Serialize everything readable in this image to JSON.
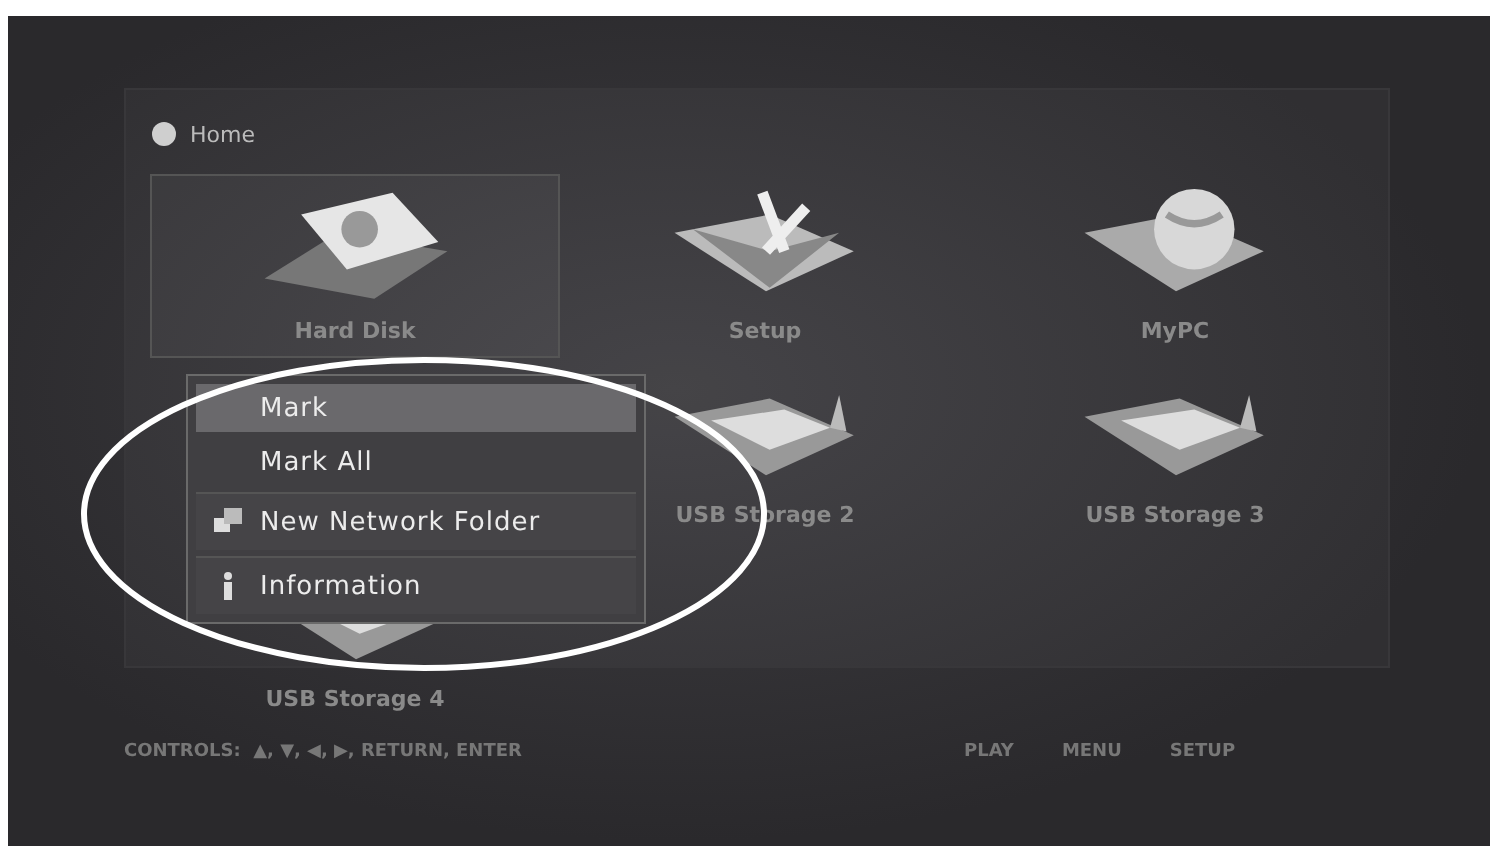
{
  "header": {
    "title": "Home"
  },
  "tiles": [
    {
      "label": "Hard Disk",
      "kind": "disk",
      "selected": true
    },
    {
      "label": "Setup",
      "kind": "tools",
      "selected": false
    },
    {
      "label": "MyPC",
      "kind": "network",
      "selected": false
    },
    {
      "label": "USB Storage 2",
      "kind": "folder",
      "selected": false
    },
    {
      "label": "USB Storage 3",
      "kind": "folder",
      "selected": false
    },
    {
      "label": "USB Storage 4",
      "kind": "folder",
      "selected": false
    }
  ],
  "context_menu": {
    "items": [
      {
        "label": "Mark",
        "kind": "plain",
        "selected": true
      },
      {
        "label": "Mark All",
        "kind": "plain",
        "selected": false
      },
      {
        "label": "New Network Folder",
        "kind": "network",
        "selected": false
      },
      {
        "label": "Information",
        "kind": "info",
        "selected": false
      }
    ]
  },
  "footer": {
    "controls": "CONTROLS:  ▲, ▼, ◀, ▶, RETURN, ENTER",
    "buttons": [
      "PLAY",
      "MENU",
      "SETUP"
    ]
  }
}
